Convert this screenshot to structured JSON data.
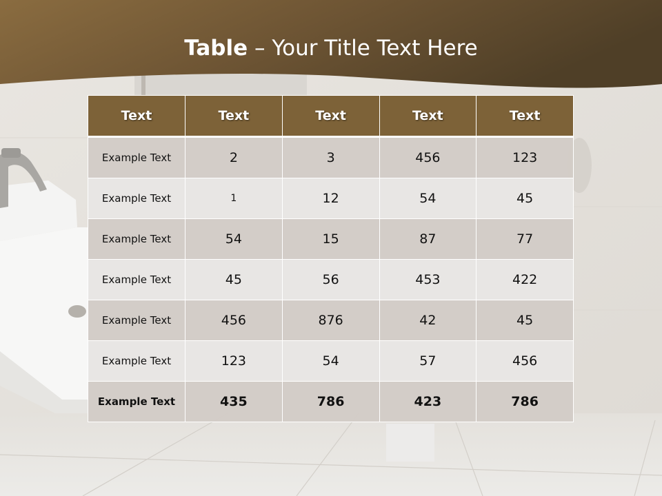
{
  "slide": {
    "title_bold": "Table",
    "title_rest": " – Your Title Text Here"
  },
  "colors": {
    "header_band": "#6b5331",
    "table_header": "#7d6238",
    "row_dark": "#d2ccc7",
    "row_light": "#e8e6e4"
  },
  "table": {
    "headers": [
      "Text",
      "Text",
      "Text",
      "Text",
      "Text"
    ],
    "rows": [
      [
        "Example Text",
        "2",
        "3",
        "456",
        "123"
      ],
      [
        "Example Text",
        "1",
        "12",
        "54",
        "45"
      ],
      [
        "Example Text",
        "54",
        "15",
        "87",
        "77"
      ],
      [
        "Example Text",
        "45",
        "56",
        "453",
        "422"
      ],
      [
        "Example Text",
        "456",
        "876",
        "42",
        "45"
      ],
      [
        "Example Text",
        "123",
        "54",
        "57",
        "456"
      ],
      [
        "Example Text",
        "435",
        "786",
        "423",
        "786"
      ]
    ]
  }
}
